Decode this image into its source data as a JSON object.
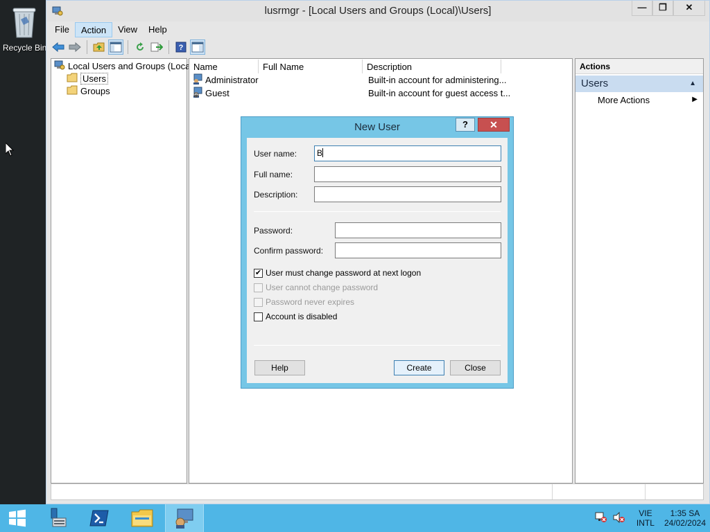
{
  "desktop": {
    "recycle_bin_label": "Recycle Bin"
  },
  "window": {
    "title": "lusrmgr - [Local Users and Groups (Local)\\Users]",
    "minimize": "—",
    "maximize": "❐",
    "close": "✕"
  },
  "menu": {
    "file": "File",
    "action": "Action",
    "view": "View",
    "help": "Help"
  },
  "tree": {
    "root": "Local Users and Groups (Local)",
    "users": "Users",
    "groups": "Groups"
  },
  "list": {
    "columns": {
      "name": "Name",
      "full_name": "Full Name",
      "description": "Description"
    },
    "rows": [
      {
        "name": "Administrator",
        "full_name": "",
        "description": "Built-in account for administering..."
      },
      {
        "name": "Guest",
        "full_name": "",
        "description": "Built-in account for guest access t..."
      }
    ]
  },
  "actions": {
    "header": "Actions",
    "section": "Users",
    "more": "More Actions"
  },
  "dialog": {
    "title": "New User",
    "help_glyph": "?",
    "close_glyph": "✕",
    "user_name_label": "User name:",
    "user_name_value": "B",
    "full_name_label": "Full name:",
    "full_name_value": "",
    "description_label": "Description:",
    "description_value": "",
    "password_label": "Password:",
    "confirm_password_label": "Confirm password:",
    "options": [
      {
        "label": "User must change password at next logon",
        "checked": true,
        "enabled": true
      },
      {
        "label": "User cannot change password",
        "checked": false,
        "enabled": false
      },
      {
        "label": "Password never expires",
        "checked": false,
        "enabled": false
      },
      {
        "label": "Account is disabled",
        "checked": false,
        "enabled": true
      }
    ],
    "help_button": "Help",
    "create_button": "Create",
    "close_button": "Close"
  },
  "taskbar": {
    "lang_line1": "VIE",
    "lang_line2": "INTL",
    "time": "1:35 SA",
    "date": "24/02/2024"
  }
}
